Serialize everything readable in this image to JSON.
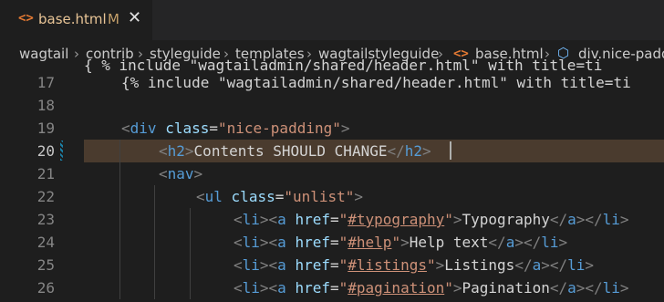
{
  "tab": {
    "file_icon": "<>",
    "name": "base.html",
    "status": "M",
    "close": "✕"
  },
  "breadcrumb": [
    "wagtail",
    "contrib",
    "styleguide",
    "templates",
    "wagtailstyleguide",
    "base.html",
    "div.nice-padding"
  ],
  "breadcrumb_sep": "›",
  "editor": {
    "partial_top": "{ % include \"wagtailadmin/shared/header.html\" with title=ti",
    "active_line": "20",
    "lines": [
      {
        "num": "17",
        "segs": [
          {
            "c": "tx",
            "t": "{% include \"wagtailadmin/shared/header.html\" with title=ti"
          }
        ]
      },
      {
        "num": "18",
        "segs": []
      },
      {
        "num": "19",
        "segs": [
          {
            "c": "tb",
            "t": "<"
          },
          {
            "c": "t",
            "t": "div"
          },
          {
            "c": "tx",
            "t": " "
          },
          {
            "c": "a",
            "t": "class"
          },
          {
            "c": "tx",
            "t": "="
          },
          {
            "c": "s",
            "t": "\"nice-padding\""
          },
          {
            "c": "tb",
            "t": ">"
          }
        ]
      },
      {
        "num": "20",
        "segs": [
          {
            "c": "tb",
            "t": "<"
          },
          {
            "c": "t",
            "t": "h2"
          },
          {
            "c": "tb",
            "t": ">"
          },
          {
            "c": "tx",
            "t": "Contents SHOULD CHANGE"
          },
          {
            "c": "tb",
            "t": "</"
          },
          {
            "c": "t",
            "t": "h2"
          },
          {
            "c": "tb",
            "t": ">"
          }
        ]
      },
      {
        "num": "21",
        "segs": [
          {
            "c": "tb",
            "t": "<"
          },
          {
            "c": "t",
            "t": "nav"
          },
          {
            "c": "tb",
            "t": ">"
          }
        ]
      },
      {
        "num": "22",
        "segs": [
          {
            "c": "tb",
            "t": "<"
          },
          {
            "c": "t",
            "t": "ul"
          },
          {
            "c": "tx",
            "t": " "
          },
          {
            "c": "a",
            "t": "class"
          },
          {
            "c": "tx",
            "t": "="
          },
          {
            "c": "s",
            "t": "\"unlist\""
          },
          {
            "c": "tb",
            "t": ">"
          }
        ]
      },
      {
        "num": "23",
        "segs": [
          {
            "c": "tb",
            "t": "<"
          },
          {
            "c": "t",
            "t": "li"
          },
          {
            "c": "tb",
            "t": "><"
          },
          {
            "c": "t",
            "t": "a"
          },
          {
            "c": "tx",
            "t": " "
          },
          {
            "c": "a",
            "t": "href"
          },
          {
            "c": "tx",
            "t": "="
          },
          {
            "c": "s",
            "t": "\""
          },
          {
            "c": "s u",
            "t": "#typography"
          },
          {
            "c": "s",
            "t": "\""
          },
          {
            "c": "tb",
            "t": ">"
          },
          {
            "c": "tx",
            "t": "Typography"
          },
          {
            "c": "tb",
            "t": "</"
          },
          {
            "c": "t",
            "t": "a"
          },
          {
            "c": "tb",
            "t": "></"
          },
          {
            "c": "t",
            "t": "li"
          },
          {
            "c": "tb",
            "t": ">"
          }
        ]
      },
      {
        "num": "24",
        "segs": [
          {
            "c": "tb",
            "t": "<"
          },
          {
            "c": "t",
            "t": "li"
          },
          {
            "c": "tb",
            "t": "><"
          },
          {
            "c": "t",
            "t": "a"
          },
          {
            "c": "tx",
            "t": " "
          },
          {
            "c": "a",
            "t": "href"
          },
          {
            "c": "tx",
            "t": "="
          },
          {
            "c": "s",
            "t": "\""
          },
          {
            "c": "s u",
            "t": "#help"
          },
          {
            "c": "s",
            "t": "\""
          },
          {
            "c": "tb",
            "t": ">"
          },
          {
            "c": "tx",
            "t": "Help text"
          },
          {
            "c": "tb",
            "t": "</"
          },
          {
            "c": "t",
            "t": "a"
          },
          {
            "c": "tb",
            "t": "></"
          },
          {
            "c": "t",
            "t": "li"
          },
          {
            "c": "tb",
            "t": ">"
          }
        ]
      },
      {
        "num": "25",
        "segs": [
          {
            "c": "tb",
            "t": "<"
          },
          {
            "c": "t",
            "t": "li"
          },
          {
            "c": "tb",
            "t": "><"
          },
          {
            "c": "t",
            "t": "a"
          },
          {
            "c": "tx",
            "t": " "
          },
          {
            "c": "a",
            "t": "href"
          },
          {
            "c": "tx",
            "t": "="
          },
          {
            "c": "s",
            "t": "\""
          },
          {
            "c": "s u",
            "t": "#listings"
          },
          {
            "c": "s",
            "t": "\""
          },
          {
            "c": "tb",
            "t": ">"
          },
          {
            "c": "tx",
            "t": "Listings"
          },
          {
            "c": "tb",
            "t": "</"
          },
          {
            "c": "t",
            "t": "a"
          },
          {
            "c": "tb",
            "t": "></"
          },
          {
            "c": "t",
            "t": "li"
          },
          {
            "c": "tb",
            "t": ">"
          }
        ]
      },
      {
        "num": "26",
        "segs": [
          {
            "c": "tb",
            "t": "<"
          },
          {
            "c": "t",
            "t": "li"
          },
          {
            "c": "tb",
            "t": "><"
          },
          {
            "c": "t",
            "t": "a"
          },
          {
            "c": "tx",
            "t": " "
          },
          {
            "c": "a",
            "t": "href"
          },
          {
            "c": "tx",
            "t": "="
          },
          {
            "c": "s",
            "t": "\""
          },
          {
            "c": "s u",
            "t": "#pagination"
          },
          {
            "c": "s",
            "t": "\""
          },
          {
            "c": "tb",
            "t": ">"
          },
          {
            "c": "tx",
            "t": "Pagination"
          },
          {
            "c": "tb",
            "t": "</"
          },
          {
            "c": "t",
            "t": "a"
          },
          {
            "c": "tb",
            "t": "></"
          },
          {
            "c": "t",
            "t": "li"
          },
          {
            "c": "tb",
            "t": ">"
          }
        ]
      }
    ]
  },
  "colors": {
    "tag": "#569cd6",
    "attr": "#9cdcfe",
    "string": "#ce9178",
    "text": "#d4d4d4",
    "bracket": "#808080",
    "highlight": "#4a3b2e"
  }
}
